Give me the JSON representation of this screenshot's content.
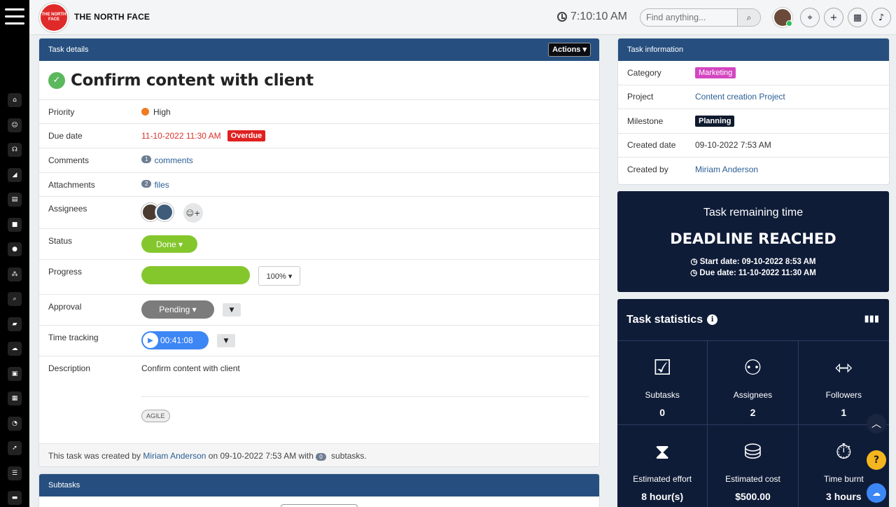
{
  "header": {
    "logo_text": "THE NORTH FACE",
    "brand": "THE NORTH FACE",
    "time": "7:10:10 AM",
    "search_placeholder": "Find anything..."
  },
  "task_card": {
    "header_title": "Task details",
    "actions_label": "Actions ▾",
    "title": "Confirm content with client",
    "fields": {
      "priority_label": "Priority",
      "priority_value": "High",
      "due_label": "Due date",
      "due_value": "11-10-2022 11:30 AM",
      "overdue_badge": "Overdue",
      "comments_label": "Comments",
      "comments_count": "1",
      "comments_link": "comments",
      "attachments_label": "Attachments",
      "attachments_count": "2",
      "attachments_link": "files",
      "assignees_label": "Assignees",
      "status_label": "Status",
      "status_value": "Done ▾",
      "progress_label": "Progress",
      "progress_value": "100%",
      "progress_select": "100% ▾",
      "approval_label": "Approval",
      "approval_value": "Pending ▾",
      "time_label": "Time tracking",
      "time_value": "00:41:08",
      "description_label": "Description",
      "description_value": "Confirm content with client",
      "tag": "AGILE"
    },
    "footer": {
      "prefix": "This task was created by",
      "creator": "Miriam Anderson",
      "middle": "on 09-10-2022 7:53 AM with",
      "subtask_count": "0",
      "suffix": "subtasks."
    }
  },
  "subtasks_card": {
    "header_title": "Subtasks"
  },
  "info_card": {
    "header_title": "Task information",
    "rows": [
      {
        "key": "Category",
        "value": "Marketing"
      },
      {
        "key": "Project",
        "value": "Content creation Project"
      },
      {
        "key": "Milestone",
        "value": "Planning"
      },
      {
        "key": "Created date",
        "value": "09-10-2022 7:53 AM"
      },
      {
        "key": "Created by",
        "value": "Miriam Anderson"
      }
    ]
  },
  "remaining": {
    "title": "Task remaining time",
    "status": "DEADLINE REACHED",
    "start": "Start date: 09-10-2022 8:53 AM",
    "due": "Due date: 11-10-2022 11:30 AM"
  },
  "stats": {
    "title": "Task statistics",
    "items": [
      {
        "name": "Subtasks",
        "value": "0"
      },
      {
        "name": "Assignees",
        "value": "2"
      },
      {
        "name": "Followers",
        "value": "1"
      },
      {
        "name": "Estimated effort",
        "value": "8 hour(s)"
      },
      {
        "name": "Estimated cost",
        "value": "$500.00"
      },
      {
        "name": "Time burnt",
        "value": "3 hours"
      }
    ]
  },
  "colors": {
    "header_blue": "#264f7f",
    "navy": "#0f1c38",
    "green": "#84c72d",
    "overdue_red": "#e02020",
    "category_pink": "#d446c1"
  }
}
